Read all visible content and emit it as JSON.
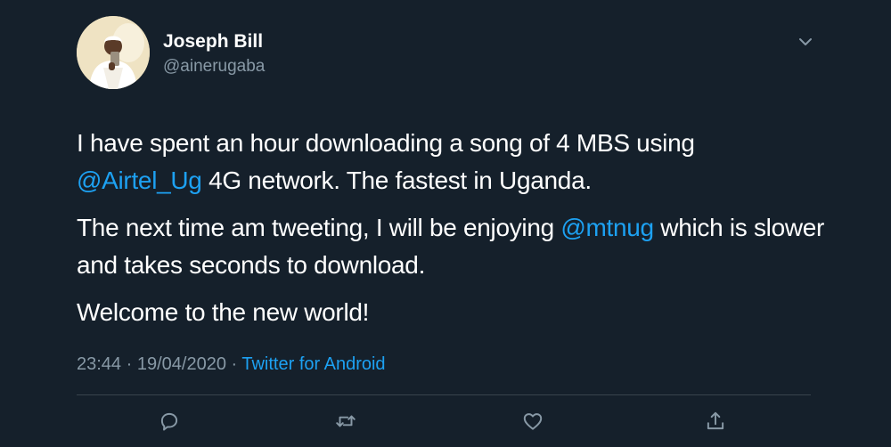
{
  "user": {
    "display_name": "Joseph Bill",
    "handle": "@ainerugaba"
  },
  "tweet": {
    "lines": [
      [
        {
          "text": "I have spent an hour downloading a song of 4 MBS using ",
          "mention": false
        },
        {
          "text": "@Airtel_Ug",
          "mention": true
        },
        {
          "text": " 4G network. The fastest in Uganda.",
          "mention": false
        }
      ],
      [
        {
          "text": "The next time am tweeting, I will be enjoying ",
          "mention": false
        },
        {
          "text": "@mtnug",
          "mention": true
        },
        {
          "text": " which is slower and takes seconds to download.",
          "mention": false
        }
      ],
      [
        {
          "text": "Welcome to the new world!",
          "mention": false
        }
      ]
    ]
  },
  "meta": {
    "time": "23:44",
    "separator": " · ",
    "date": "19/04/2020",
    "source": "Twitter for Android"
  },
  "icons": {
    "caret": "chevron-down-icon",
    "reply": "reply-icon",
    "retweet": "retweet-icon",
    "like": "like-icon",
    "share": "share-icon"
  },
  "colors": {
    "background": "#15202b",
    "text": "#ffffff",
    "secondary": "#8899a6",
    "accent": "#1da1f2",
    "divider": "#38444d"
  }
}
